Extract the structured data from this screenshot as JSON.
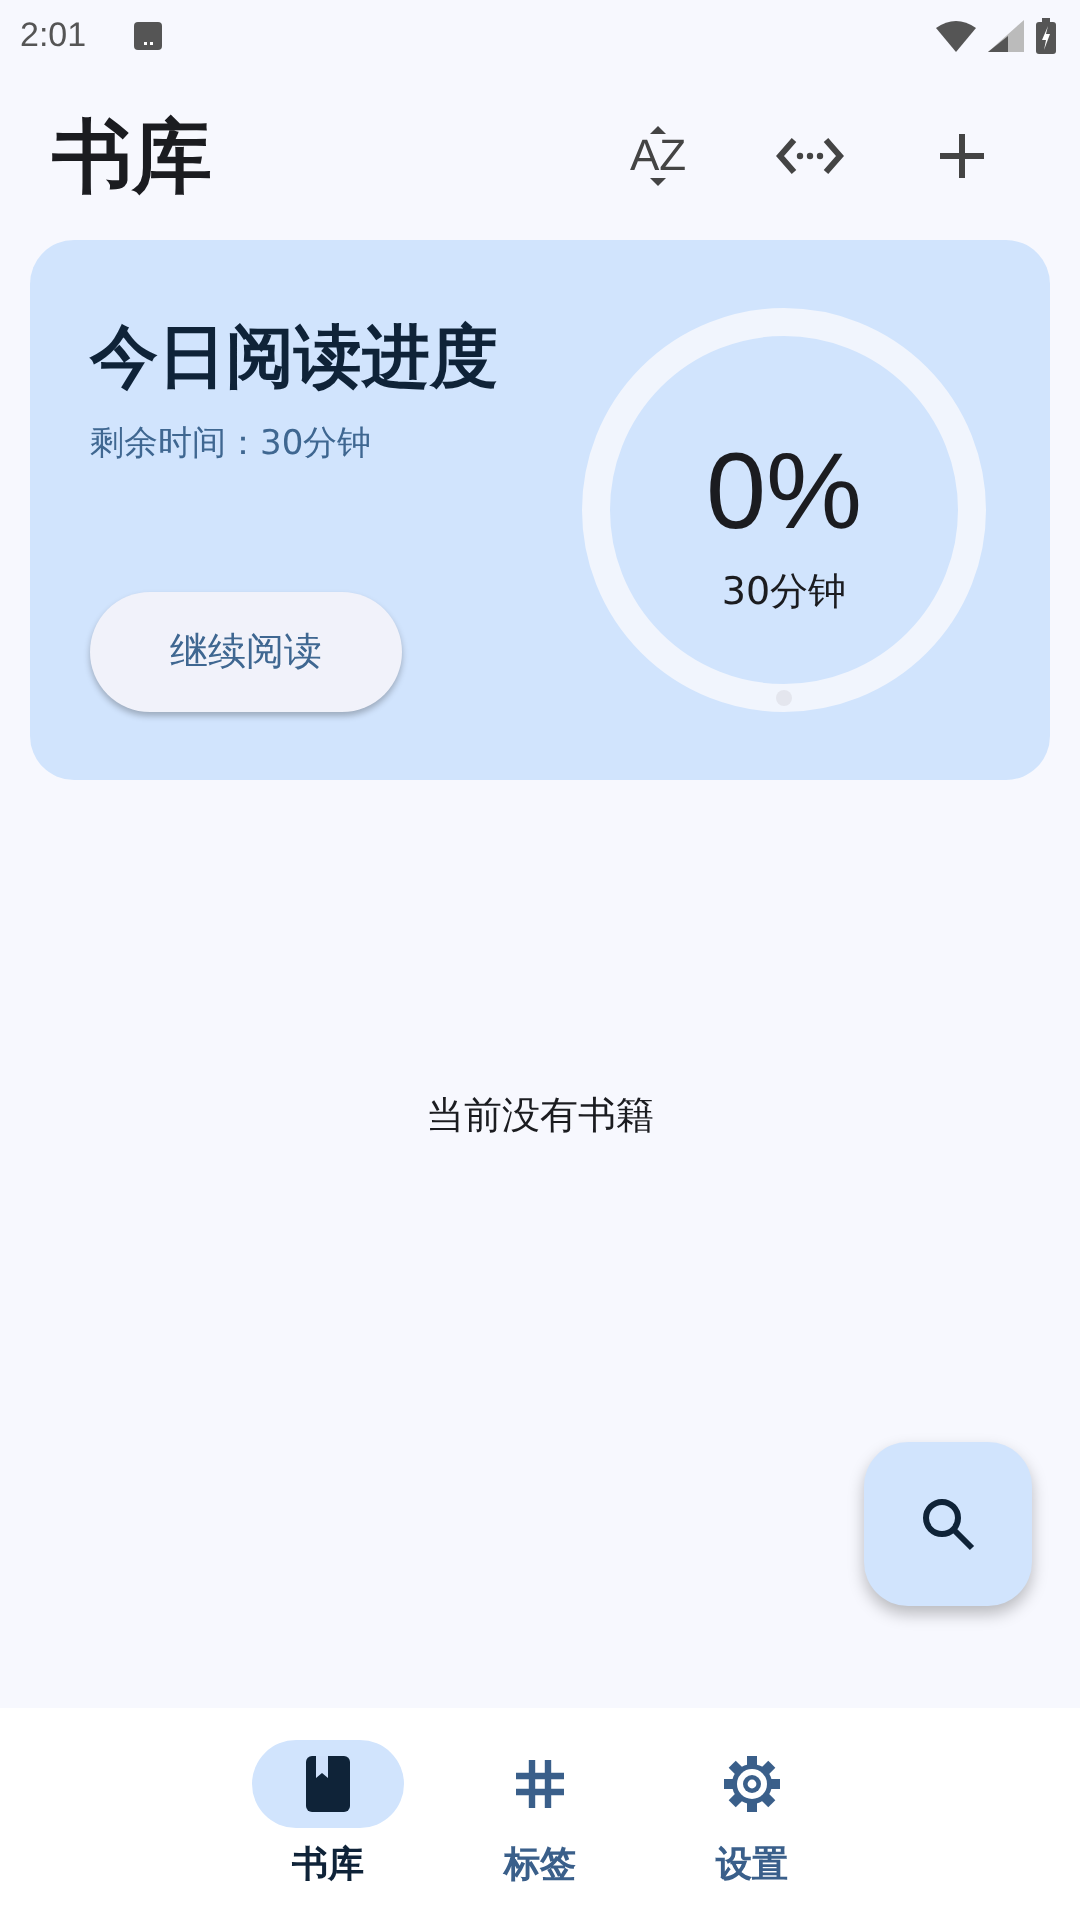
{
  "status_bar": {
    "time": "2:01"
  },
  "header": {
    "title": "书库",
    "sort_label": "AZ"
  },
  "progress_card": {
    "title": "今日阅读进度",
    "remaining": "剩余时间：30分钟",
    "button": "继续阅读",
    "percent": "0%",
    "goal": "30分钟"
  },
  "empty_message": "当前没有书籍",
  "nav": [
    {
      "label": "书库",
      "selected": true
    },
    {
      "label": "标签",
      "selected": false
    },
    {
      "label": "设置",
      "selected": false
    }
  ]
}
